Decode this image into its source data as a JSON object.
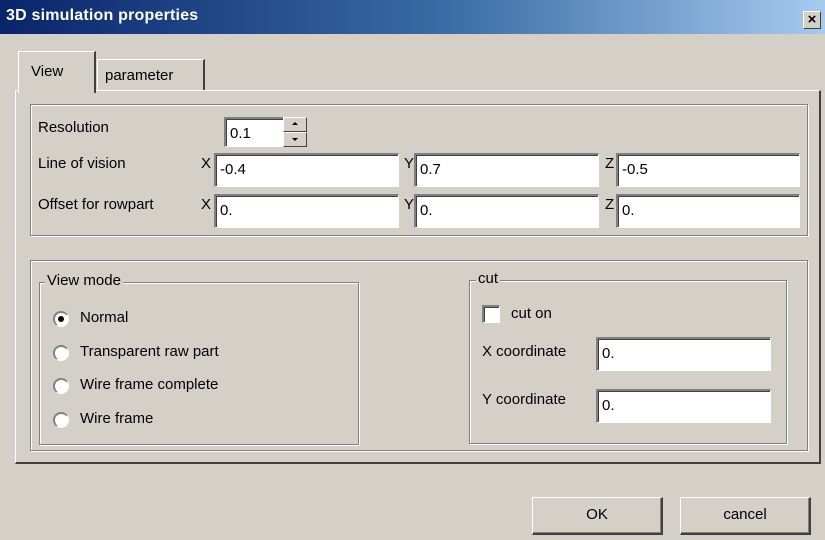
{
  "window": {
    "title": "3D simulation properties",
    "close_label": "×"
  },
  "tabs": [
    {
      "label": "View",
      "active": true
    },
    {
      "label": "parameter",
      "active": false
    }
  ],
  "view_tab": {
    "resolution": {
      "label": "Resolution",
      "value": "0.1"
    },
    "line_of_vision": {
      "label": "Line of vision",
      "x_label": "X",
      "x_value": "-0.4",
      "y_label": "Y",
      "y_value": "0.7",
      "z_label": "Z",
      "z_value": "-0.5"
    },
    "offset_rowpart": {
      "label": "Offset for rowpart",
      "x_label": "X",
      "x_value": "0.",
      "y_label": "Y",
      "y_value": "0.",
      "z_label": "Z",
      "z_value": "0."
    },
    "view_mode": {
      "legend": "View mode",
      "options": [
        {
          "label": "Normal",
          "selected": true
        },
        {
          "label": "Transparent raw part",
          "selected": false
        },
        {
          "label": "Wire frame complete",
          "selected": false
        },
        {
          "label": "Wire frame",
          "selected": false
        }
      ]
    },
    "cut": {
      "legend": "cut",
      "cut_on_label": "cut on",
      "cut_on_checked": false,
      "x_coordinate_label": "X coordinate",
      "x_coordinate_value": "0.",
      "y_coordinate_label": "Y coordinate",
      "y_coordinate_value": "0."
    }
  },
  "buttons": {
    "ok_label": "OK",
    "cancel_label": "cancel"
  },
  "colors": {
    "face": "#d4d0c8",
    "titlebar_start": "#0a246a",
    "titlebar_end": "#a6caf0"
  }
}
